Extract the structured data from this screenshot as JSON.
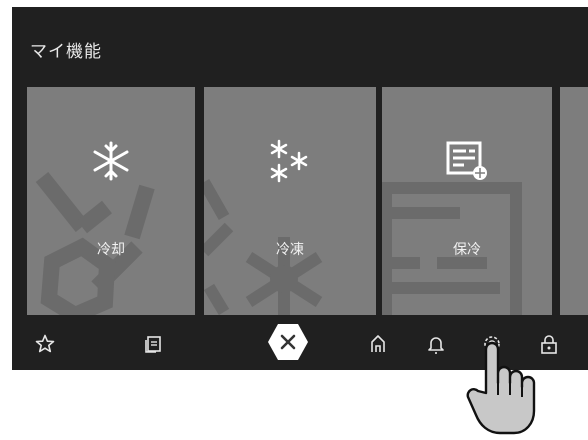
{
  "header": {
    "title": "マイ機能"
  },
  "tiles": [
    {
      "label": "冷却",
      "icon": "snowflake-icon"
    },
    {
      "label": "冷凍",
      "icon": "multi-snowflake-icon"
    },
    {
      "label": "保冷",
      "icon": "document-cool-icon"
    }
  ],
  "bottom_bar": {
    "items": [
      "star-icon",
      "notes-icon",
      "close-icon",
      "home-icon",
      "bell-icon",
      "settings-icon",
      "lock-icon"
    ]
  },
  "colors": {
    "screen_bg": "#202020",
    "tile_bg": "#7d7d7d",
    "close_bg": "#ffffff"
  }
}
